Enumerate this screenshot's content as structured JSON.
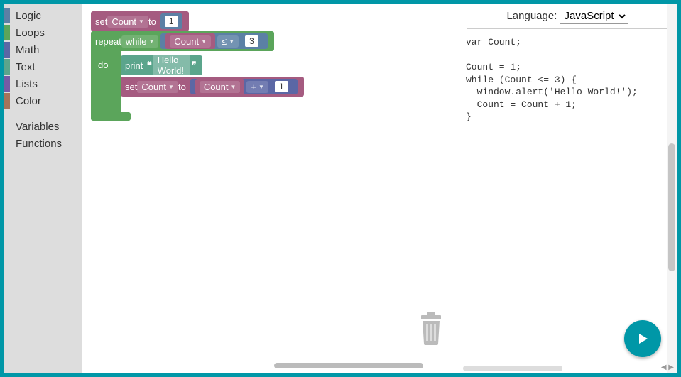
{
  "toolbox": {
    "categories": [
      {
        "label": "Logic",
        "color": "#5b80a5"
      },
      {
        "label": "Loops",
        "color": "#5ba55b"
      },
      {
        "label": "Math",
        "color": "#5b67a5"
      },
      {
        "label": "Text",
        "color": "#5ba58c"
      },
      {
        "label": "Lists",
        "color": "#745ba5"
      },
      {
        "label": "Color",
        "color": "#a5745b"
      }
    ],
    "extra": [
      {
        "label": "Variables"
      },
      {
        "label": "Functions"
      }
    ]
  },
  "workspace": {
    "set1": {
      "set": "set",
      "var": "Count",
      "to": "to",
      "val": "1"
    },
    "repeat": {
      "repeat": "repeat",
      "mode": "while",
      "var": "Count",
      "op": "≤",
      "rhs": "3"
    },
    "do": "do",
    "print": {
      "label": "print",
      "text": "Hello World!"
    },
    "set2": {
      "set": "set",
      "var": "Count",
      "to": "to",
      "inc_var": "Count",
      "inc_op": "+",
      "inc_val": "1"
    }
  },
  "code_panel": {
    "lang_label": "Language:",
    "lang_value": "JavaScript",
    "code": "var Count;\n\nCount = 1;\nwhile (Count <= 3) {\n  window.alert('Hello World!');\n  Count = Count + 1;\n}"
  }
}
